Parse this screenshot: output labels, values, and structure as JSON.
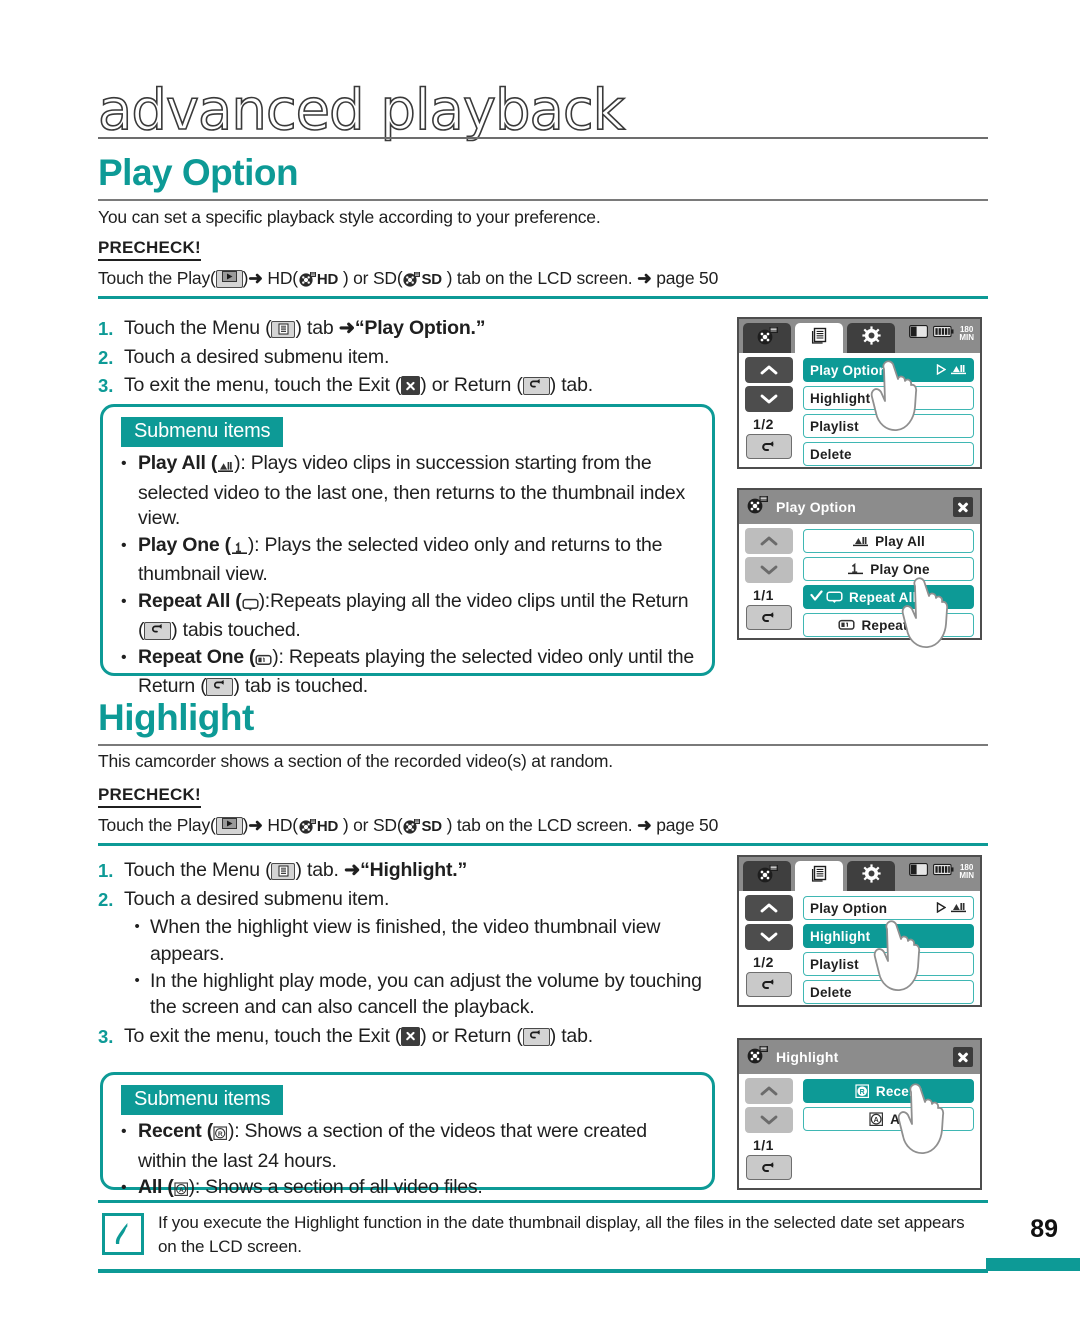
{
  "chapter": {
    "title": "advanced playback"
  },
  "colors": {
    "teal": "#0d9a96",
    "teal_light": "#3fb7b3",
    "text": "#1f1f1f"
  },
  "page_number": "89",
  "sections": [
    {
      "id": "play-option",
      "title": "Play Option",
      "intro": "You can set a specific playback style according to your preference.",
      "precheck_label": "PRECHECK!",
      "precheck": {
        "p1": "Touch the Play(",
        "p2": ")",
        "arrow": "➜",
        "p3": " HD(",
        "hd": "HD",
        "p4": " ) or SD(",
        "sd": "SD",
        "p5": " ) tab on the LCD screen. ",
        "ref_arrow": "➜",
        "p6": " page 50"
      },
      "steps": [
        {
          "num": "1.",
          "a": "Touch the Menu (",
          "b": ") tab ",
          "arrow": "➜",
          "c": "“Play Option.”"
        },
        {
          "num": "2.",
          "a": "Touch a desired submenu item."
        },
        {
          "num": "3.",
          "a": "To exit the menu, touch the Exit (",
          "b": ") or Return (",
          "c": ") tab."
        }
      ],
      "callout": {
        "badge": "Submenu items",
        "items": [
          {
            "name": "Play All",
            "icon": "play-all-icon",
            "desc": "): Plays video clips in succession starting from the selected video to the last one, then returns to the thumbnail index view."
          },
          {
            "name": "Play One",
            "icon": "play-one-icon",
            "desc": "): Plays the selected video only and returns to the thumbnail view."
          },
          {
            "name": "Repeat All",
            "icon": "repeat-all-icon",
            "desc": "):Repeats playing all the video clips until the Return (",
            "desc2": ") tabis touched."
          },
          {
            "name": "Repeat One",
            "icon": "repeat-one-icon",
            "desc": "): Repeats playing the selected video only until the Return (",
            "desc2": ") tab is touched."
          }
        ]
      }
    },
    {
      "id": "highlight",
      "title": "Highlight",
      "intro": "This camcorder shows a section of the recorded video(s) at random.",
      "precheck_label": "PRECHECK!",
      "precheck": {
        "p1": "Touch the Play(",
        "p2": ")",
        "arrow": "➜",
        "p3": " HD(",
        "hd": "HD",
        "p4": " ) or SD(",
        "sd": "SD",
        "p5": " ) tab on the LCD screen. ",
        "ref_arrow": "➜",
        "p6": " page 50"
      },
      "steps": [
        {
          "num": "1.",
          "a": "Touch the Menu (",
          "b": ") tab. ",
          "arrow": "➜",
          "c": "“Highlight.”"
        },
        {
          "num": "2.",
          "a": "Touch a desired submenu item.",
          "subs": [
            "When the highlight view is finished, the video thumbnail view appears.",
            "In the highlight play mode, you can adjust the volume by touching the screen and can also cancell the playback."
          ]
        },
        {
          "num": "3.",
          "a": "To exit the menu, touch the Exit (",
          "b": ") or Return (",
          "c": ") tab."
        }
      ],
      "callout": {
        "badge": "Submenu items",
        "items": [
          {
            "name": "Recent",
            "icon": "recent-icon",
            "desc": "): Shows a section of the videos that were created within the last 24 hours."
          },
          {
            "name": "All",
            "icon": "all-icon",
            "desc": "): Shows a section of all video files."
          }
        ]
      }
    }
  ],
  "lcd_screens": [
    {
      "id": "menu-play-option",
      "type": "tabbed",
      "tabs": [
        {
          "icon": "film-reel-icon",
          "state": "dark"
        },
        {
          "icon": "menu-pages-icon",
          "state": "active"
        },
        {
          "icon": "gear-icon",
          "state": "dark"
        }
      ],
      "status": {
        "card": "card-icon",
        "battery": "battery-icon",
        "time": "180",
        "time_unit": "MIN"
      },
      "page_indicator": "1/2",
      "rows": [
        {
          "label": "Play Option",
          "selected": true,
          "right_icon": "play-arrow-icon",
          "right_icon2": "play-all-icon"
        },
        {
          "label": "Highlight",
          "selected": false
        },
        {
          "label": "Playlist",
          "selected": false
        },
        {
          "label": "Delete",
          "selected": false
        }
      ],
      "hand": true
    },
    {
      "id": "play-option-submenu",
      "type": "titled",
      "title": "Play Option",
      "title_icon": "film-reel-icon",
      "close": "close-icon",
      "page_indicator": "1/1",
      "rows": [
        {
          "label": "Play All",
          "icon": "play-all-icon",
          "selected": false
        },
        {
          "label": "Play One",
          "icon": "play-one-icon",
          "selected": false
        },
        {
          "label": "Repeat All",
          "icon": "repeat-all-icon",
          "selected": true,
          "check": true
        },
        {
          "label": "Repeat One",
          "icon": "repeat-one-icon",
          "selected": false
        }
      ],
      "hand": true
    },
    {
      "id": "menu-highlight",
      "type": "tabbed",
      "tabs": [
        {
          "icon": "film-reel-icon",
          "state": "dark"
        },
        {
          "icon": "menu-pages-icon",
          "state": "active"
        },
        {
          "icon": "gear-icon",
          "state": "dark"
        }
      ],
      "status": {
        "card": "card-icon",
        "battery": "battery-icon",
        "time": "180",
        "time_unit": "MIN"
      },
      "page_indicator": "1/2",
      "rows": [
        {
          "label": "Play Option",
          "selected": false,
          "right_icon": "play-arrow-icon",
          "right_icon2": "play-all-icon"
        },
        {
          "label": "Highlight",
          "selected": true
        },
        {
          "label": "Playlist",
          "selected": false
        },
        {
          "label": "Delete",
          "selected": false
        }
      ],
      "hand": true
    },
    {
      "id": "highlight-submenu",
      "type": "titled",
      "title": "Highlight",
      "title_icon": "film-reel-icon",
      "close": "close-icon",
      "page_indicator": "1/1",
      "rows": [
        {
          "label": "Recent",
          "icon": "recent-icon",
          "selected": true
        },
        {
          "label": "All",
          "icon": "all-icon",
          "selected": false
        }
      ],
      "hand": true
    }
  ],
  "note": {
    "icon": "note-feather-icon",
    "text": "If you execute the Highlight function in the date thumbnail display, all the files in the selected date set appears on the LCD screen."
  }
}
